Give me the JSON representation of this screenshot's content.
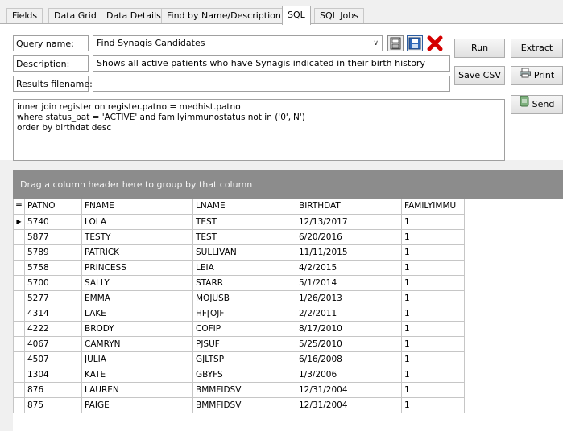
{
  "tabs": [
    {
      "label": "Fields",
      "active": false
    },
    {
      "label": "Data Grid",
      "active": false
    },
    {
      "label": "Data Details",
      "active": false
    },
    {
      "label": "Find by Name/Description",
      "active": false
    },
    {
      "label": "SQL",
      "active": true
    },
    {
      "label": "SQL Jobs",
      "active": false
    }
  ],
  "form": {
    "query_name_label": "Query name:",
    "query_name_value": "Find Synagis Candidates",
    "description_label": "Description:",
    "description_value": "Shows all active patients who have Synagis indicated in their birth history",
    "results_filename_label": "Results filename:",
    "results_filename_value": ""
  },
  "buttons": {
    "run": "Run",
    "extract": "Extract",
    "save_csv": "Save CSV",
    "print": "Print",
    "send": "Send"
  },
  "icons": [
    "save-icon",
    "save-as-icon",
    "delete-icon",
    "print-icon",
    "send-icon"
  ],
  "sql_text": "inner join register on register.patno = medhist.patno\nwhere status_pat = 'ACTIVE' and familyimmunostatus not in ('0','N')\norder by birthdat desc",
  "group_panel_text": "Drag a column header here to group by that column",
  "grid": {
    "columns": [
      "PATNO",
      "FNAME",
      "LNAME",
      "BIRTHDAT",
      "FAMILYIMMU"
    ],
    "rows": [
      [
        "5740",
        "LOLA",
        "TEST",
        "12/13/2017",
        "1"
      ],
      [
        "5877",
        "TESTY",
        "TEST",
        "6/20/2016",
        "1"
      ],
      [
        "5789",
        "PATRICK",
        "SULLIVAN",
        "11/11/2015",
        "1"
      ],
      [
        "5758",
        "PRINCESS",
        "LEIA",
        "4/2/2015",
        "1"
      ],
      [
        "5700",
        "SALLY",
        "STARR",
        "5/1/2014",
        "1"
      ],
      [
        "5277",
        "EMMA",
        "MOJUSB",
        "1/26/2013",
        "1"
      ],
      [
        "4314",
        "LAKE",
        "HF[OJF",
        "2/2/2011",
        "1"
      ],
      [
        "4222",
        "BRODY",
        "COFIP",
        "8/17/2010",
        "1"
      ],
      [
        "4067",
        "CAMRYN",
        "PJSUF",
        "5/25/2010",
        "1"
      ],
      [
        "4507",
        "JULIA",
        "GJLTSP",
        "6/16/2008",
        "1"
      ],
      [
        "1304",
        "KATE",
        "GBYFS",
        "1/3/2006",
        "1"
      ],
      [
        "876",
        "LAUREN",
        "BMMFIDSV",
        "12/31/2004",
        "1"
      ],
      [
        "875",
        "PAIGE",
        "BMMFIDSV",
        "12/31/2004",
        "1"
      ]
    ]
  }
}
